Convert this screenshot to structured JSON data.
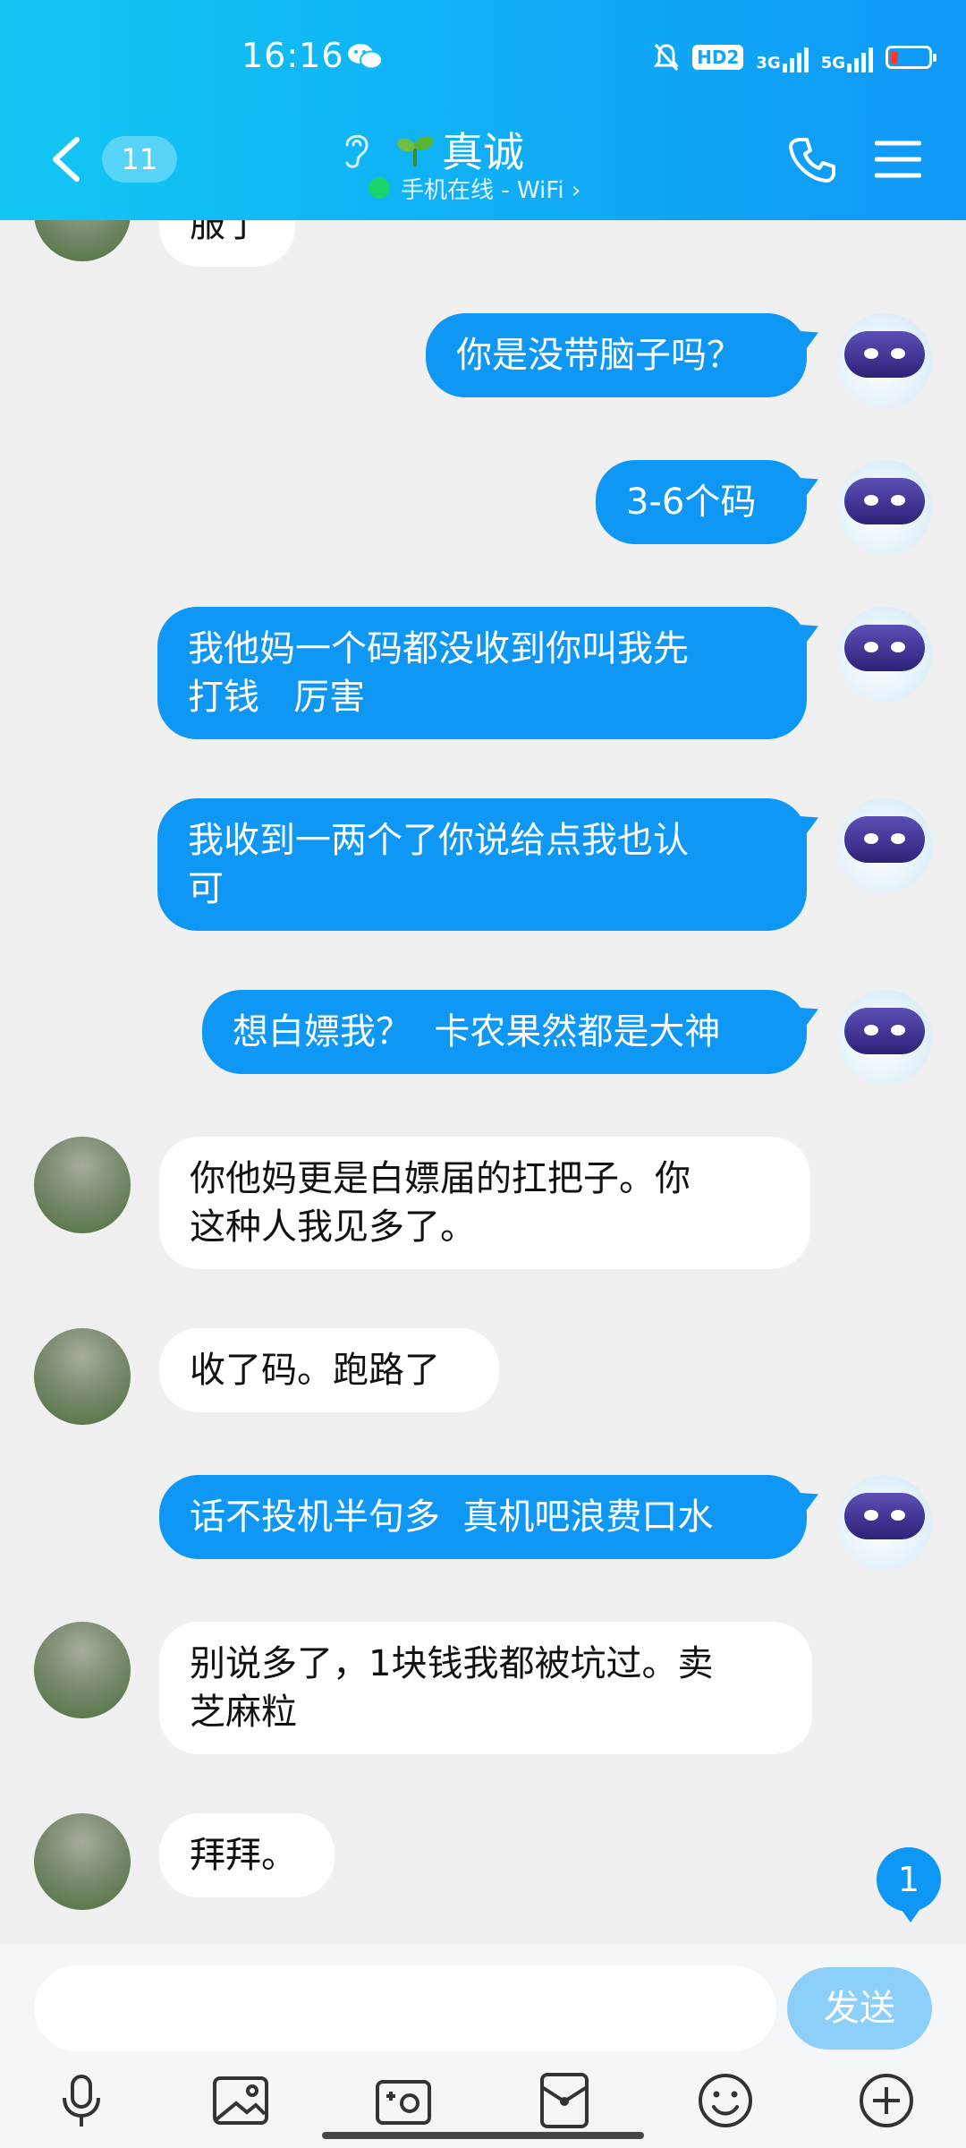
{
  "status_bar": {
    "time": "16:16",
    "hd_label": "HD2",
    "net1": "3G",
    "net2": "5G",
    "battery_color": "#ff3b30"
  },
  "header": {
    "back_icon": "chevron-left-icon",
    "unread_count": "11",
    "contact_name": "真诚",
    "online_status": "手机在线 - WiFi ›",
    "icons": [
      "ear-icon",
      "sprout-icon",
      "phone-icon",
      "menu-icon"
    ],
    "accent_color": "#10aff6"
  },
  "messages": [
    {
      "side": "in",
      "text": "服了"
    },
    {
      "side": "out",
      "text": "你是没带脑子吗？"
    },
    {
      "side": "out",
      "text": "3-6个码"
    },
    {
      "side": "out",
      "text": "我他妈一个码都没收到你叫我先\n打钱   厉害"
    },
    {
      "side": "out",
      "text": "我收到一两个了你说给点我也认\n可"
    },
    {
      "side": "out",
      "text": "想白嫖我？  卡农果然都是大神"
    },
    {
      "side": "in",
      "text": "你他妈更是白嫖届的扛把子。你\n这种人我见多了。"
    },
    {
      "side": "in",
      "text": "收了码。跑路了"
    },
    {
      "side": "out",
      "text": "话不投机半句多  真机吧浪费口水"
    },
    {
      "side": "in",
      "text": "别说多了，1块钱我都被坑过。卖\n芝麻粒"
    },
    {
      "side": "in",
      "text": "拜拜。"
    }
  ],
  "new_message_count": "1",
  "input": {
    "value": "",
    "placeholder": "",
    "send_label": "发送"
  },
  "toolbar": [
    "microphone-icon",
    "image-icon",
    "camera-icon",
    "red-packet-icon",
    "emoji-icon",
    "plus-icon"
  ]
}
